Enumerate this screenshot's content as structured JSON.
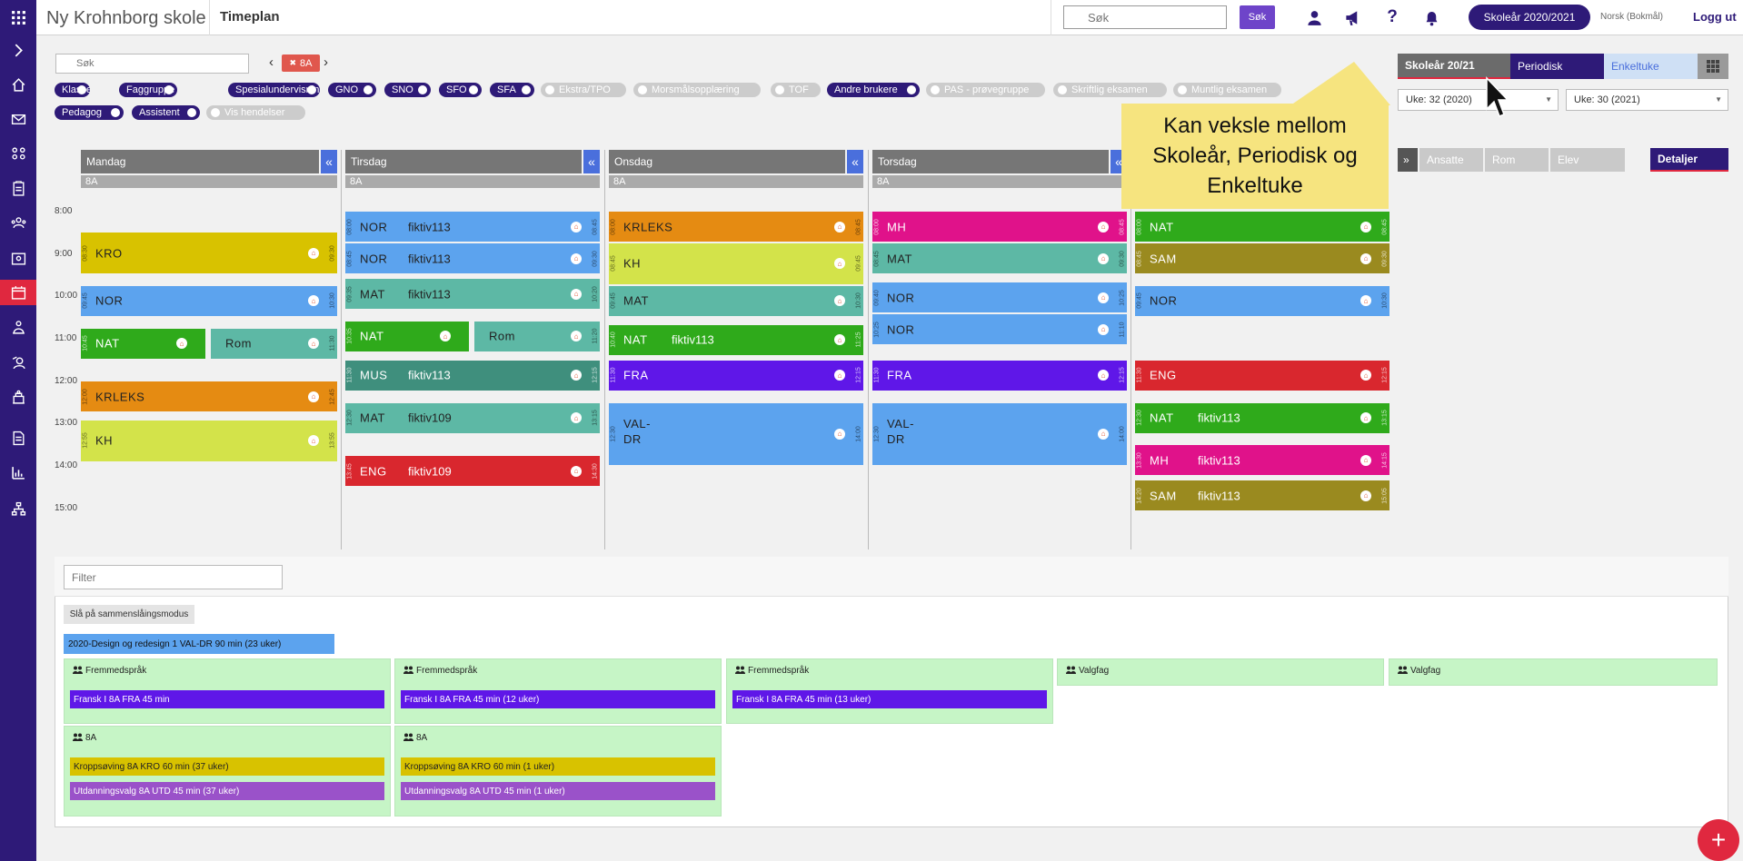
{
  "header": {
    "school_name": "Ny Krohnborg skole",
    "page_title": "Timeplan",
    "search_placeholder": "Søk",
    "search_button": "Søk",
    "year_button": "Skoleår 2020/2021",
    "language": "Norsk (Bokmål)",
    "logout": "Logg ut"
  },
  "nav_icons": [
    "apps-grid-icon",
    "expand-chevron-icon",
    "home-icon",
    "mail-icon",
    "groups-icon",
    "clipboard-icon",
    "people-icon",
    "calendar-person-icon",
    "timetable-icon",
    "teacher-icon",
    "student-icon",
    "building-icon",
    "document-icon",
    "chart-icon",
    "organization-icon"
  ],
  "filters": {
    "search_placeholder": "Søk",
    "selected_class": "8A",
    "toggles": [
      {
        "label": "Klasse",
        "on": true
      },
      {
        "label": "Faggruppe",
        "on": true
      },
      {
        "label": "Spesialundervisning",
        "on": true
      },
      {
        "label": "GNO",
        "on": true
      },
      {
        "label": "SNO",
        "on": true
      },
      {
        "label": "SFO",
        "on": true
      },
      {
        "label": "SFA",
        "on": true
      },
      {
        "label": "Ekstra/TPO",
        "on": false
      },
      {
        "label": "Morsmålsopplæring",
        "on": false
      },
      {
        "label": "TOF",
        "on": false
      },
      {
        "label": "Andre brukere",
        "on": true
      },
      {
        "label": "PAS - prøvegruppe",
        "on": false
      },
      {
        "label": "Skriftlig eksamen",
        "on": false
      },
      {
        "label": "Muntlig eksamen",
        "on": false
      },
      {
        "label": "Pedagog",
        "on": true
      },
      {
        "label": "Assistent",
        "on": true
      },
      {
        "label": "Vis hendelser",
        "on": false
      }
    ]
  },
  "view_tabs": {
    "skolear": "Skoleår 20/21",
    "periodisk": "Periodisk",
    "enkeltuke": "Enkeltuke"
  },
  "week_from": "Uke: 32 (2020)",
  "week_to": "Uke: 30 (2021)",
  "right_tabs": {
    "expand": "»",
    "ansatte": "Ansatte",
    "rom": "Rom",
    "elev": "Elev",
    "detaljer": "Detaljer"
  },
  "tooltip": "Kan veksle mellom Skoleår, Periodisk og Enkeltuke",
  "time_labels": [
    "8:00",
    "9:00",
    "10:00",
    "11:00",
    "12:00",
    "13:00",
    "14:00",
    "15:00"
  ],
  "days": [
    {
      "name": "Mandag",
      "class": "8A",
      "events": [
        {
          "subject": "KRO",
          "start": "08:30",
          "end": "09:30",
          "color": "#d8c200"
        },
        {
          "subject": "NOR",
          "start": "09:45",
          "end": "10:30",
          "color": "#5ca3ee"
        },
        {
          "subject": "NAT",
          "start": "10:45",
          "end": "",
          "color": "#2faa1b"
        },
        {
          "subject": "Rom",
          "start": "",
          "end": "11:30",
          "color": "#5db8a5"
        },
        {
          "subject": "KRLEKS",
          "start": "12:00",
          "end": "12:45",
          "color": "#e58b12"
        },
        {
          "subject": "KH",
          "start": "12:55",
          "end": "13:55",
          "color": "#d3e34a"
        }
      ]
    },
    {
      "name": "Tirsdag",
      "class": "8A",
      "events": [
        {
          "subject": "NOR",
          "room": "fiktiv113",
          "start": "08:00",
          "end": "08:45",
          "color": "#5ca3ee"
        },
        {
          "subject": "NOR",
          "room": "fiktiv113",
          "start": "08:45",
          "end": "09:30",
          "color": "#5ca3ee"
        },
        {
          "subject": "MAT",
          "room": "fiktiv113",
          "start": "09:35",
          "end": "10:20",
          "color": "#5db8a5"
        },
        {
          "subject": "NAT",
          "start": "10:35",
          "end": "",
          "color": "#2faa1b"
        },
        {
          "subject": "Rom",
          "start": "",
          "end": "11:20",
          "color": "#5db8a5"
        },
        {
          "subject": "MUS",
          "room": "fiktiv113",
          "start": "11:30",
          "end": "12:15",
          "color": "#3f8f7d"
        },
        {
          "subject": "MAT",
          "room": "fiktiv109",
          "start": "12:30",
          "end": "13:15",
          "color": "#5db8a5"
        },
        {
          "subject": "ENG",
          "room": "fiktiv109",
          "start": "13:45",
          "end": "14:30",
          "color": "#d9272e"
        }
      ]
    },
    {
      "name": "Onsdag",
      "class": "8A",
      "events": [
        {
          "subject": "KRLEKS",
          "start": "08:00",
          "end": "08:45",
          "color": "#e58b12"
        },
        {
          "subject": "KH",
          "start": "08:45",
          "end": "09:45",
          "color": "#d3e34a"
        },
        {
          "subject": "MAT",
          "start": "09:45",
          "end": "10:30",
          "color": "#5db8a5"
        },
        {
          "subject": "NAT",
          "room": "fiktiv113",
          "start": "10:40",
          "end": "11:25",
          "color": "#2faa1b"
        },
        {
          "subject": "FRA",
          "start": "11:30",
          "end": "12:15",
          "color": "#5f17e8"
        },
        {
          "subject": "VAL-DR",
          "start": "12:30",
          "end": "14:00",
          "color": "#5ca3ee"
        }
      ]
    },
    {
      "name": "Torsdag",
      "class": "8A",
      "events": [
        {
          "subject": "MH",
          "start": "08:00",
          "end": "08:45",
          "color": "#e0128a"
        },
        {
          "subject": "MAT",
          "start": "08:45",
          "end": "09:30",
          "color": "#5db8a5"
        },
        {
          "subject": "NOR",
          "start": "09:40",
          "end": "10:25",
          "color": "#5ca3ee"
        },
        {
          "subject": "NOR",
          "start": "10:25",
          "end": "11:10",
          "color": "#5ca3ee"
        },
        {
          "subject": "FRA",
          "start": "11:30",
          "end": "12:15",
          "color": "#5f17e8"
        },
        {
          "subject": "VAL-DR",
          "start": "12:30",
          "end": "14:00",
          "color": "#5ca3ee"
        }
      ]
    },
    {
      "name": "",
      "class": "",
      "events": [
        {
          "subject": "NAT",
          "start": "08:00",
          "end": "08:45",
          "color": "#2faa1b"
        },
        {
          "subject": "SAM",
          "start": "08:45",
          "end": "09:30",
          "color": "#9a8a1f"
        },
        {
          "subject": "NOR",
          "start": "09:45",
          "end": "10:30",
          "color": "#5ca3ee"
        },
        {
          "subject": "ENG",
          "start": "11:30",
          "end": "12:15",
          "color": "#d9272e"
        },
        {
          "subject": "NAT",
          "room": "fiktiv113",
          "start": "12:30",
          "end": "13:15",
          "color": "#2faa1b"
        },
        {
          "subject": "MH",
          "room": "fiktiv113",
          "start": "13:30",
          "end": "14:15",
          "color": "#e0128a"
        },
        {
          "subject": "SAM",
          "room": "fiktiv113",
          "start": "14:20",
          "end": "15:05",
          "color": "#9a8a1f"
        }
      ]
    }
  ],
  "lower": {
    "filter_placeholder": "Filter",
    "merge_button": "Slå på sammenslåingsmodus",
    "unplaced": "2020-Design og redesign 1 VAL-DR 90 min (23 uker)",
    "groups": [
      {
        "title": "Fremmedspråk",
        "bars": [
          {
            "text": "Fransk I 8A FRA 45 min",
            "color": "#5f17e8"
          }
        ]
      },
      {
        "title": "Fremmedspråk",
        "bars": [
          {
            "text": "Fransk I 8A FRA 45 min (12 uker)",
            "color": "#5f17e8"
          }
        ]
      },
      {
        "title": "Fremmedspråk",
        "bars": [
          {
            "text": "Fransk I 8A FRA 45 min (13 uker)",
            "color": "#5f17e8"
          }
        ]
      },
      {
        "title": "Valgfag",
        "bars": []
      },
      {
        "title": "Valgfag",
        "bars": []
      },
      {
        "title": "8A",
        "bars": [
          {
            "text": "Kroppsøving 8A KRO 60 min (37 uker)",
            "color": "#d8c200"
          },
          {
            "text": "Utdanningsvalg 8A UTD 45 min (37 uker)",
            "color": "#9a52c9"
          }
        ]
      },
      {
        "title": "8A",
        "bars": [
          {
            "text": "Kroppsøving 8A KRO 60 min (1 uker)",
            "color": "#d8c200"
          },
          {
            "text": "Utdanningsvalg 8A UTD 45 min (1 uker)",
            "color": "#9a52c9"
          }
        ]
      }
    ]
  },
  "fab": "+"
}
